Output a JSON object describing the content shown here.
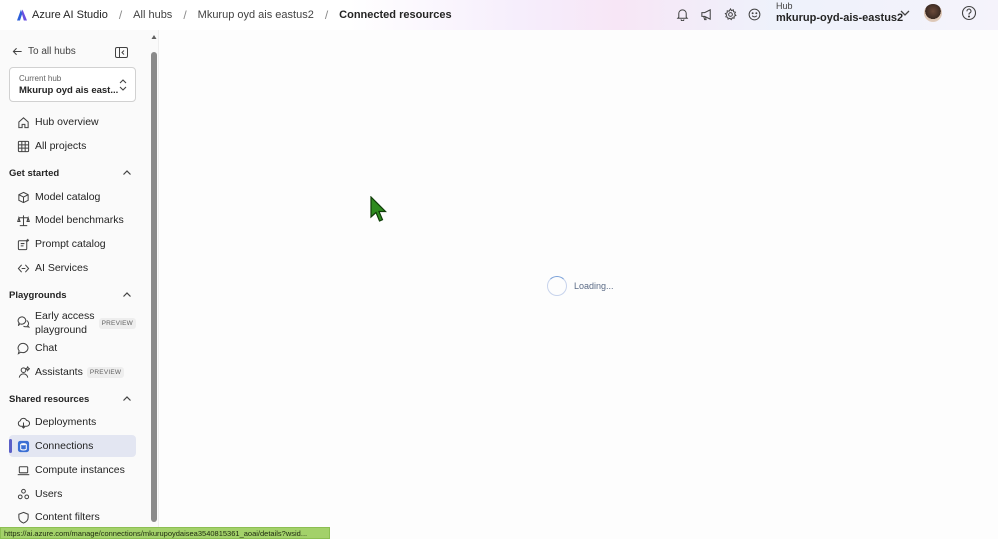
{
  "topbar": {
    "brand": "Azure AI Studio",
    "breadcrumbs": [
      "All hubs",
      "Mkurup oyd ais eastus2",
      "Connected resources"
    ],
    "separator": "/",
    "icons": [
      "bell-icon",
      "megaphone-icon",
      "gear-icon",
      "smiley-icon"
    ],
    "hub_label": "Hub",
    "hub_name": "mkurup-oyd-ais-eastus2"
  },
  "sidebar": {
    "back_label": "To all hubs",
    "current_hub_caption": "Current hub",
    "current_hub_value": "Mkurup oyd ais east...",
    "top_items": [
      {
        "label": "Hub overview",
        "icon": "home-icon"
      },
      {
        "label": "All projects",
        "icon": "grid-icon"
      }
    ],
    "sections": {
      "get_started": {
        "title": "Get started",
        "items": [
          {
            "label": "Model catalog",
            "icon": "cube-icon"
          },
          {
            "label": "Model benchmarks",
            "icon": "scale-icon"
          },
          {
            "label": "Prompt catalog",
            "icon": "prompt-icon"
          },
          {
            "label": "AI Services",
            "icon": "ai-services-icon"
          }
        ]
      },
      "playgrounds": {
        "title": "Playgrounds",
        "items": [
          {
            "label": "Early access playground",
            "icon": "chat-bubbles-icon",
            "badge": "PREVIEW"
          },
          {
            "label": "Chat",
            "icon": "chat-icon"
          },
          {
            "label": "Assistants",
            "icon": "assistant-icon",
            "badge": "PREVIEW"
          }
        ]
      },
      "shared_resources": {
        "title": "Shared resources",
        "items": [
          {
            "label": "Deployments",
            "icon": "cloud-icon"
          },
          {
            "label": "Connections",
            "icon": "database-icon",
            "selected": true
          },
          {
            "label": "Compute instances",
            "icon": "laptop-icon"
          },
          {
            "label": "Users",
            "icon": "people-icon"
          },
          {
            "label": "Content filters",
            "icon": "shield-icon"
          }
        ]
      }
    }
  },
  "main": {
    "loading_text": "Loading..."
  },
  "status_url": "https://ai.azure.com/manage/connections/mkurupoydaisea3540815361_aoai/details?wsid..."
}
